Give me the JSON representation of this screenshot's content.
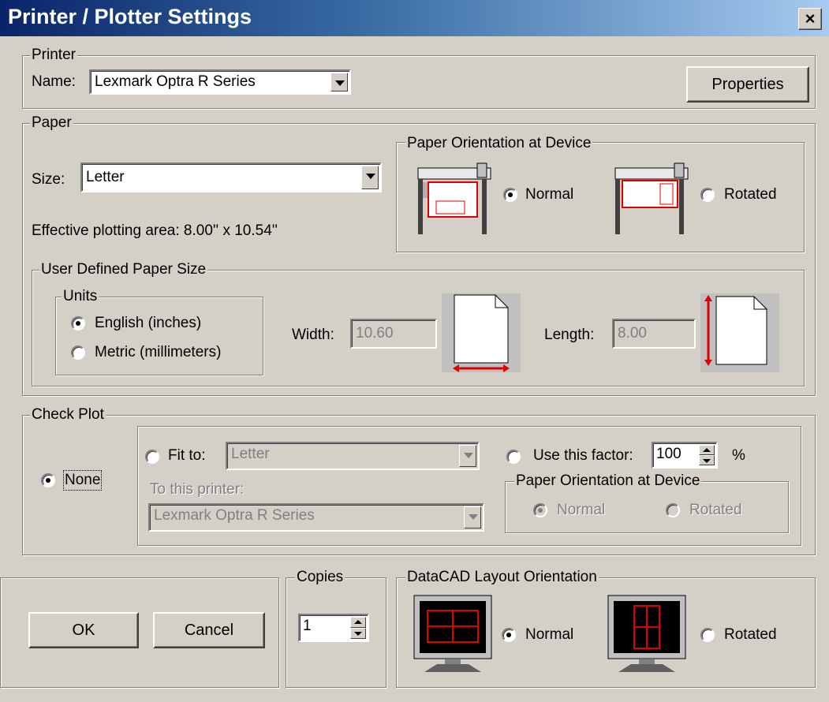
{
  "window": {
    "title": "Printer / Plotter Settings",
    "close_glyph": "×"
  },
  "printer": {
    "group_label": "Printer",
    "name_label": "Name:",
    "name_value": "Lexmark Optra R Series",
    "properties_button": "Properties"
  },
  "paper": {
    "group_label": "Paper",
    "size_label": "Size:",
    "size_value": "Letter",
    "effective_area": "Effective plotting area: 8.00'' x 10.54''",
    "orientation": {
      "group_label": "Paper Orientation at Device",
      "normal": "Normal",
      "rotated": "Rotated",
      "selected": "normal"
    },
    "user_defined": {
      "group_label": "User Defined Paper Size",
      "units": {
        "group_label": "Units",
        "english": "English (inches)",
        "metric": "Metric (millimeters)",
        "selected": "english"
      },
      "width_label": "Width:",
      "width_value": "10.60",
      "length_label": "Length:",
      "length_value": "8.00"
    }
  },
  "check_plot": {
    "group_label": "Check Plot",
    "none_label": "None",
    "fit_to_label": "Fit to:",
    "fit_to_value": "Letter",
    "use_factor_label": "Use this factor:",
    "factor_value": "100",
    "percent": "%",
    "to_printer_label": "To this printer:",
    "to_printer_value": "Lexmark Optra R Series",
    "orientation": {
      "group_label": "Paper Orientation at Device",
      "normal": "Normal",
      "rotated": "Rotated"
    },
    "selected": "none"
  },
  "buttons": {
    "ok": "OK",
    "cancel": "Cancel"
  },
  "copies": {
    "group_label": "Copies",
    "value": "1"
  },
  "layout": {
    "group_label": "DataCAD Layout Orientation",
    "normal": "Normal",
    "rotated": "Rotated",
    "selected": "normal"
  },
  "colors": {
    "title_start": "#0a246a",
    "title_end": "#a6caf0",
    "dialog_bg": "#d4d0c8",
    "accent_red": "#e00000"
  }
}
